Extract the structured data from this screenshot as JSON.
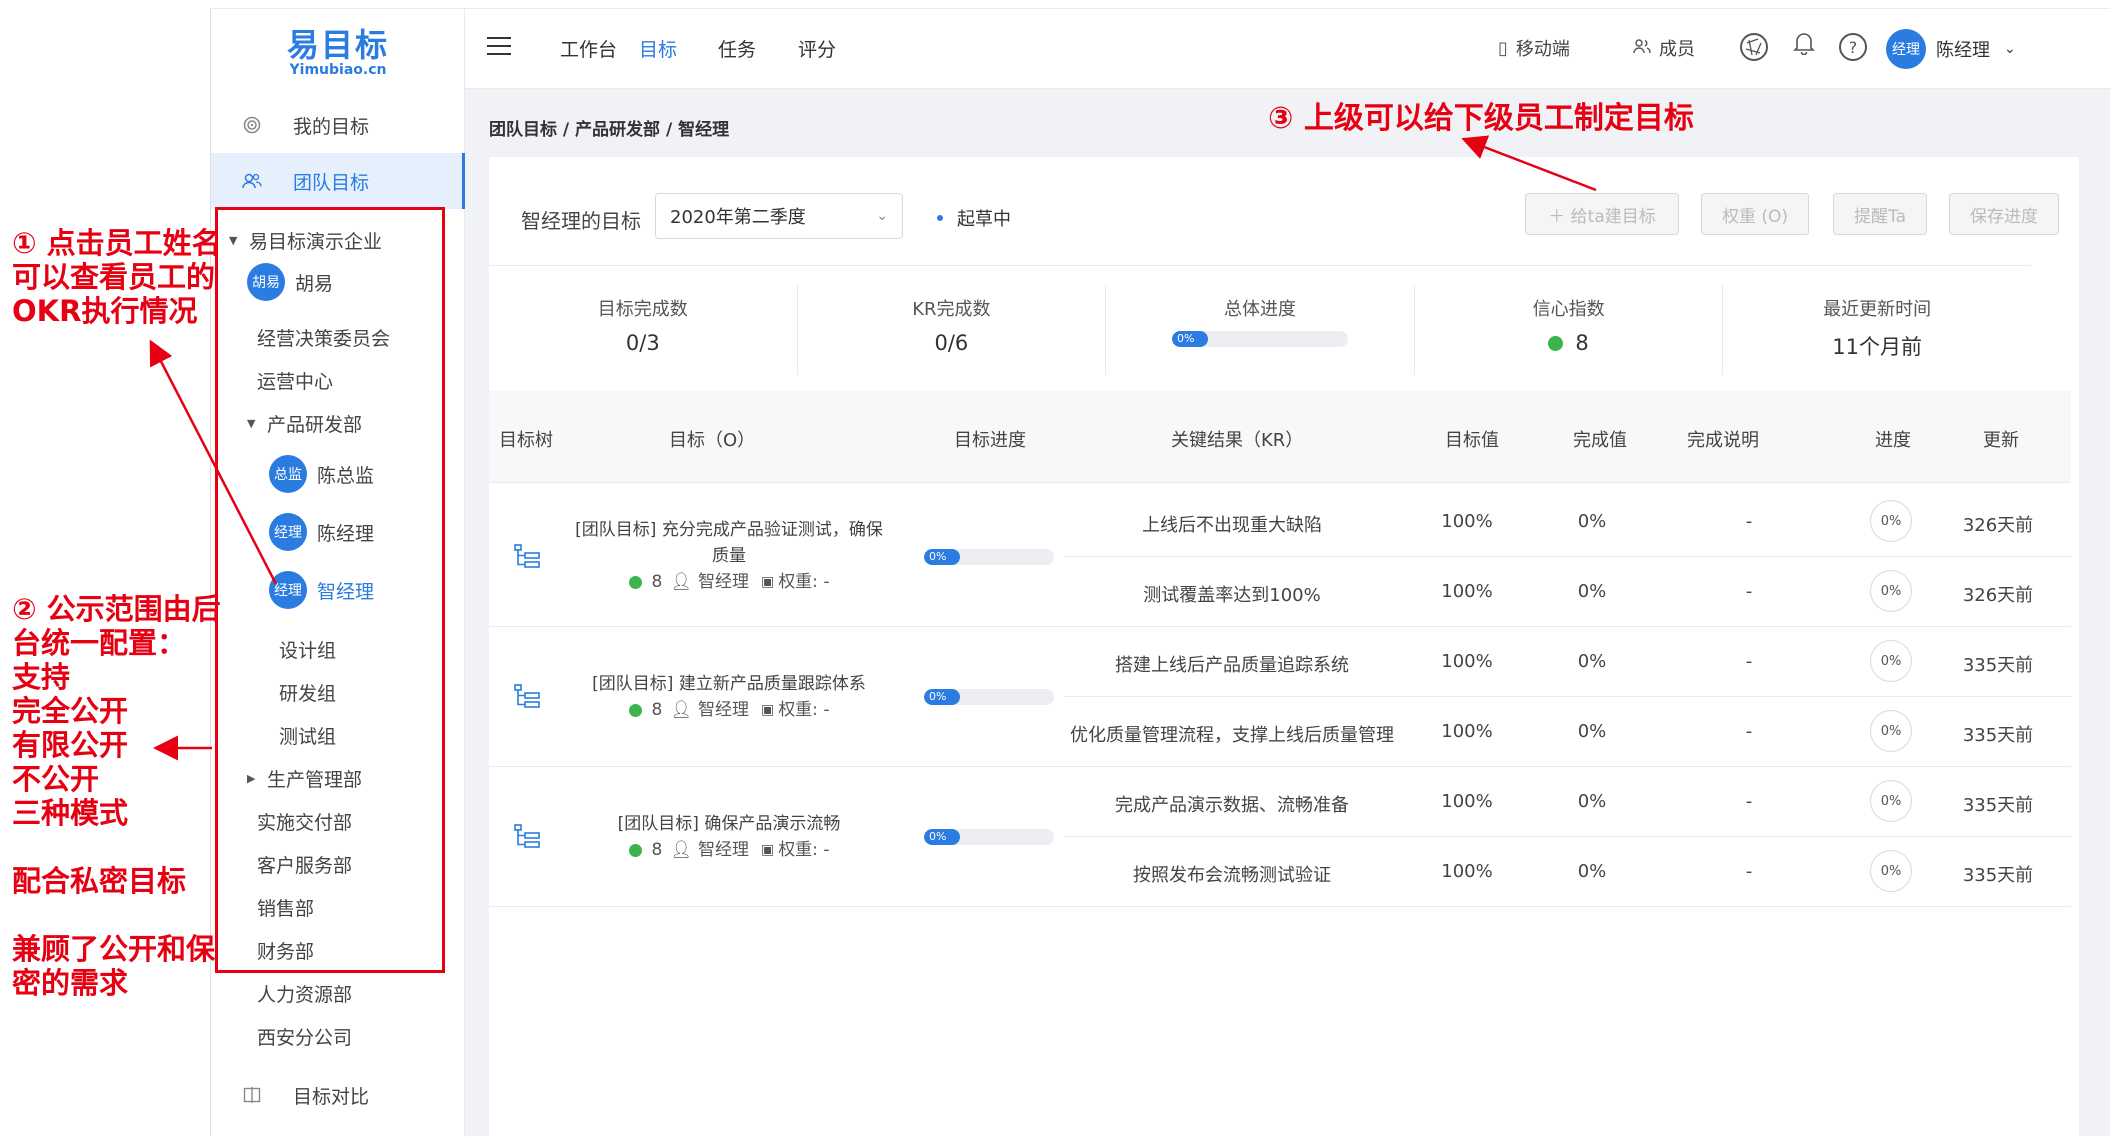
{
  "annotations": {
    "a1": "① 点击员工姓名\n可以查看员工的\nOKR执行情况",
    "a2": "② 公示范围由后\n台统一配置：\n支持\n完全公开\n有限公开\n不公开\n三种模式\n\n配合私密目标\n\n兼顾了公开和保\n密的需求",
    "a3": "③  上级可以给下级员工制定目标"
  },
  "logo": {
    "main": "易目标",
    "sub": "Yimubiao.cn"
  },
  "sidebar": {
    "my_goals": "我的目标",
    "team_goals": "团队目标",
    "compare": "目标对比",
    "tree": [
      "易目标演示企业",
      "胡易",
      "经营决策委员会",
      "运营中心",
      "产品研发部",
      "陈总监",
      "陈经理",
      "智经理",
      "设计组",
      "研发组",
      "测试组",
      "生产管理部",
      "实施交付部",
      "客户服务部",
      "销售部",
      "财务部",
      "人力资源部",
      "西安分公司"
    ],
    "avatars": {
      "huyi": "胡易",
      "zongjian": "总监",
      "jingli": "经理"
    }
  },
  "topbar": {
    "tabs": [
      "工作台",
      "目标",
      "任务",
      "评分"
    ],
    "mobile": "移动端",
    "members": "成员",
    "help": "?",
    "user_avatar": "经理",
    "user_name": "陈经理"
  },
  "breadcrumb": "团队目标 / 产品研发部 / 智经理",
  "header": {
    "owner_title": "智经理的目标",
    "period": "2020年第二季度",
    "status": "起草中",
    "buttons": [
      "＋  给ta建目标",
      "权重 (O)",
      "提醒Ta",
      "保存进度"
    ]
  },
  "stats": [
    {
      "label": "目标完成数",
      "value": "0/3"
    },
    {
      "label": "KR完成数",
      "value": "0/6"
    },
    {
      "label": "总体进度",
      "value": "0%",
      "progress": 0
    },
    {
      "label": "信心指数",
      "value": "8"
    },
    {
      "label": "最近更新时间",
      "value": "11个月前"
    }
  ],
  "table": {
    "headers": [
      "目标树",
      "目标（O）",
      "目标进度",
      "关键结果（KR）",
      "目标值",
      "完成值",
      "完成说明",
      "进度",
      "更新"
    ],
    "objectives": [
      {
        "title": "[团队目标] 充分完成产品验证测试，确保质量",
        "confidence": "8",
        "owner": "智经理",
        "weight": "权重: -",
        "progress_label": "0%",
        "progress": 0,
        "krs": [
          {
            "name": "上线后不出现重大缺陷",
            "target": "100%",
            "done": "0%",
            "note": "-",
            "progress": "0%",
            "updated": "326天前"
          },
          {
            "name": "测试覆盖率达到100%",
            "target": "100%",
            "done": "0%",
            "note": "-",
            "progress": "0%",
            "updated": "326天前"
          }
        ]
      },
      {
        "title": "[团队目标] 建立新产品质量跟踪体系",
        "confidence": "8",
        "owner": "智经理",
        "weight": "权重: -",
        "progress_label": "0%",
        "progress": 0,
        "krs": [
          {
            "name": "搭建上线后产品质量追踪系统",
            "target": "100%",
            "done": "0%",
            "note": "-",
            "progress": "0%",
            "updated": "335天前"
          },
          {
            "name": "优化质量管理流程，支撑上线后质量管理",
            "target": "100%",
            "done": "0%",
            "note": "-",
            "progress": "0%",
            "updated": "335天前"
          }
        ]
      },
      {
        "title": "[团队目标] 确保产品演示流畅",
        "confidence": "8",
        "owner": "智经理",
        "weight": "权重: -",
        "progress_label": "0%",
        "progress": 0,
        "krs": [
          {
            "name": "完成产品演示数据、流畅准备",
            "target": "100%",
            "done": "0%",
            "note": "-",
            "progress": "0%",
            "updated": "335天前"
          },
          {
            "name": "按照发布会流畅测试验证",
            "target": "100%",
            "done": "0%",
            "note": "-",
            "progress": "0%",
            "updated": "335天前"
          }
        ]
      }
    ]
  },
  "colors": {
    "accent": "#2a7ce0",
    "annotation": "#e60012",
    "success": "#3bb54a"
  }
}
